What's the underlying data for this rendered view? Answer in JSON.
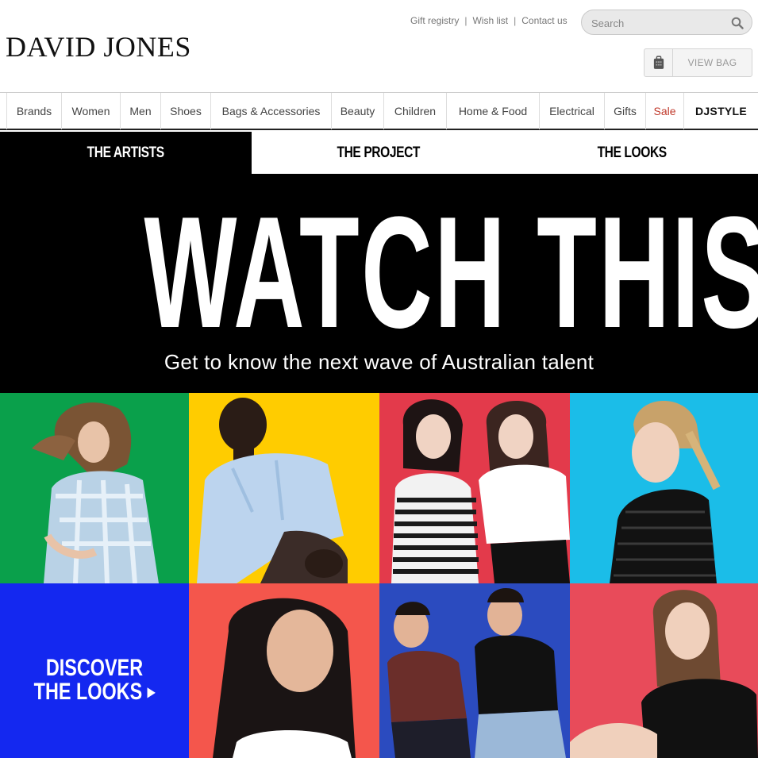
{
  "brand": {
    "logo_text": "DAVID JONES"
  },
  "utility": {
    "links": [
      "Gift registry",
      "Wish list",
      "Contact us"
    ],
    "search_placeholder": "Search",
    "bag_label": "VIEW BAG"
  },
  "nav": {
    "items": [
      "Brands",
      "Women",
      "Men",
      "Shoes",
      "Bags & Accessories",
      "Beauty",
      "Children",
      "Home & Food",
      "Electrical",
      "Gifts",
      "Sale",
      "DJSTYLE"
    ]
  },
  "tabs": [
    "THE ARTISTS",
    "THE PROJECT",
    "THE LOOKS"
  ],
  "hero": {
    "title": "WATCH THIS SPACE",
    "subtitle": "Get to know the next wave of Australian talent"
  },
  "promo": {
    "line1": "DISCOVER",
    "line2": "THE LOOKS",
    "arrow": "▶"
  },
  "colors": {
    "green": "#0aa04b",
    "yellow": "#ffcc00",
    "red": "#e33a4b",
    "cyan": "#1bbde8",
    "blue": "#1428f0",
    "coral": "#f4564c",
    "royal": "#2b4bbf",
    "pink_red": "#e84b5a",
    "sale_red": "#c0392b"
  }
}
